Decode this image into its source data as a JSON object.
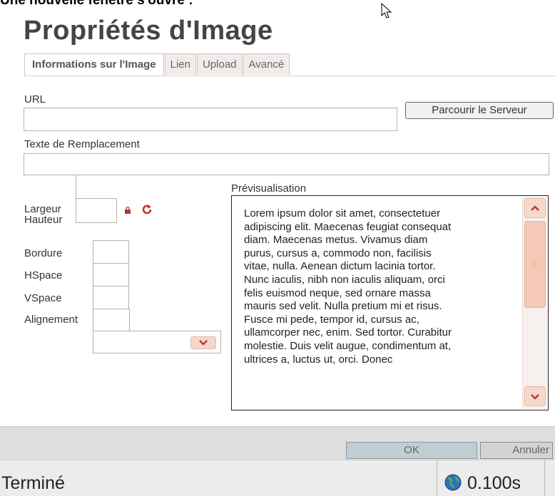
{
  "caption": "Une nouvelle fenêtre s'ouvre :",
  "dialog": {
    "title": "Propriétés d'Image",
    "tabs": [
      {
        "label": "Informations sur l'Image",
        "active": true
      },
      {
        "label": "Lien",
        "active": false
      },
      {
        "label": "Upload",
        "active": false
      },
      {
        "label": "Avancé",
        "active": false
      }
    ]
  },
  "form": {
    "url_label": "URL",
    "url_value": "",
    "browse_button": "Parcourir le Serveur",
    "alt_label": "Texte de Remplacement",
    "alt_value": "",
    "width_label": "Largeur",
    "height_label": "Hauteur",
    "border_label": "Bordure",
    "hspace_label": "HSpace",
    "vspace_label": "VSpace",
    "align_label": "Alignement",
    "align_value": ""
  },
  "preview": {
    "label": "Prévisualisation",
    "lines": [
      "Lorem ipsum dolor sit amet, consectetuer",
      "adipiscing elit. Maecenas feugiat consequat",
      "diam. Maecenas metus. Vivamus diam",
      "purus, cursus a, commodo non, facilisis",
      "vitae, nulla. Aenean dictum lacinia tortor.",
      "Nunc iaculis, nibh non iaculis aliquam, orci",
      "felis euismod neque, sed ornare massa",
      "mauris sed velit. Nulla pretium mi et risus.",
      "Fusce mi pede, tempor id, cursus ac,",
      "ullamcorper nec, enim. Sed tortor. Curabitur",
      "molestie. Duis velit augue, condimentum at,",
      "ultrices a, luctus ut, orci. Donec"
    ]
  },
  "footer": {
    "ok_button": "OK",
    "cancel_button": "Annuler"
  },
  "status_bar": {
    "status": "Terminé",
    "timing": "0.100s"
  },
  "colors": {
    "accent_scroll": "#f4c9b5",
    "footer_bg": "#dedede",
    "ok_bg": "#c1ccd3"
  }
}
